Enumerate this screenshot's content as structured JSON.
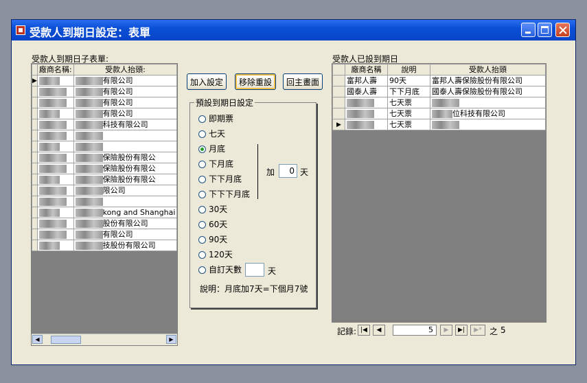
{
  "window": {
    "title": "受款人到期日設定：表單",
    "buttons": [
      "minimize",
      "maximize",
      "close"
    ]
  },
  "left_panel": {
    "label": "受款人到期日子表單:",
    "columns": [
      "廠商名稱:",
      "受款人抬頭:"
    ],
    "rows": [
      {
        "payee_suffix": "有限公司"
      },
      {
        "payee_suffix": "有限公司"
      },
      {
        "payee_suffix": "有限公司"
      },
      {
        "payee_suffix": "有限公司"
      },
      {
        "payee_suffix": "科技有限公司"
      },
      {
        "payee_suffix": ""
      },
      {
        "payee_suffix": ""
      },
      {
        "payee_suffix": "保險股份有限公"
      },
      {
        "payee_suffix": "保險股份有限公"
      },
      {
        "payee_suffix": "保險股份有限公"
      },
      {
        "payee_suffix": "限公司"
      },
      {
        "payee_suffix": ""
      },
      {
        "payee_suffix": "kong and Shanghai"
      },
      {
        "payee_suffix": "股份有限公司"
      },
      {
        "payee_suffix": "有限公司"
      },
      {
        "payee_suffix": "技股份有限公司"
      }
    ]
  },
  "buttons": {
    "add": "加入設定",
    "reset": "移除重設",
    "home": "回主畫面"
  },
  "preset": {
    "title": "預設到期日設定",
    "options": [
      "即期票",
      "七天",
      "月底",
      "下月底",
      "下下月底",
      "下下下月底",
      "30天",
      "60天",
      "90天",
      "120天",
      "自訂天數"
    ],
    "selected": "月底",
    "add_label": "加",
    "add_value": "0",
    "add_unit": "天",
    "custom_unit": "天",
    "note": "說明：月底加7天=下個月7號"
  },
  "right_panel": {
    "label": "受款人已設到期日",
    "columns": [
      "廠商名稱",
      "說明",
      "受款人抬頭"
    ],
    "rows": [
      {
        "vendor": "富邦人壽",
        "desc": "90天",
        "payee": "富邦人壽保險股份有限公司"
      },
      {
        "vendor": "國泰人壽",
        "desc": "下下月底",
        "payee": "國泰人壽保險股份有限公司"
      },
      {
        "vendor": "",
        "desc": "七天票",
        "payee": ""
      },
      {
        "vendor": "",
        "desc": "七天票",
        "payee": "位科技有限公司"
      },
      {
        "vendor": "",
        "desc": "七天票",
        "payee": ""
      }
    ],
    "nav": {
      "label": "記錄:",
      "current": "5",
      "of_label": "之",
      "total": "5"
    }
  }
}
